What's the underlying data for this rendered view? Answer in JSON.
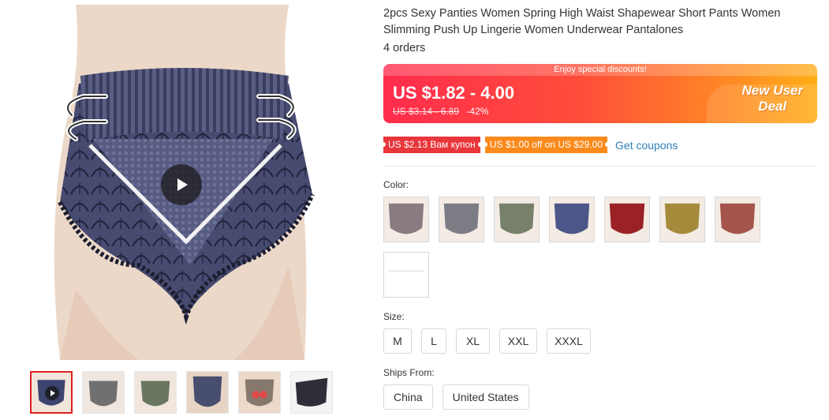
{
  "product": {
    "title": "2pcs Sexy Panties Women Spring High Waist Shapewear Short Pants Women Slimming Push Up Lingerie Women Underwear Pantalones",
    "orders": "4 orders"
  },
  "price": {
    "banner": "Enjoy special discounts!",
    "current": "US $1.82 - 4.00",
    "original": "US $3.14 - 6.89",
    "discount": "-42%",
    "badge_line1": "New User",
    "badge_line2": "Deal"
  },
  "coupons": {
    "items": [
      {
        "label": "US $2.13 Вам купон",
        "color": "#e8363b"
      },
      {
        "label": "US $1.00 off on US $29.00",
        "color": "#fa8a1c"
      }
    ],
    "get_label": "Get coupons"
  },
  "color_section": {
    "label": "Color:",
    "swatches": [
      {
        "name": "grey-pink",
        "fill": "#8a7a82"
      },
      {
        "name": "grey",
        "fill": "#7c7c84"
      },
      {
        "name": "green",
        "fill": "#76806a"
      },
      {
        "name": "blue",
        "fill": "#4c5688"
      },
      {
        "name": "red",
        "fill": "#9a2226"
      },
      {
        "name": "yellow",
        "fill": "#a48a3a"
      },
      {
        "name": "brick",
        "fill": "#a4544a"
      },
      {
        "name": "blank",
        "fill": "#ffffff"
      }
    ]
  },
  "size_section": {
    "label": "Size:",
    "options": [
      "M",
      "L",
      "XL",
      "XXL",
      "XXXL"
    ]
  },
  "ships_section": {
    "label": "Ships From:",
    "options": [
      "China",
      "United States"
    ]
  },
  "gallery": {
    "thumbs": [
      {
        "fill": "#3e4470",
        "play": true
      },
      {
        "fill": "#707070",
        "play": false
      },
      {
        "fill": "#6a7660",
        "play": false
      },
      {
        "fill": "#484e70",
        "play": false
      },
      {
        "fill": "#86786c",
        "play": false
      },
      {
        "fill": "#2e2e38",
        "play": false
      }
    ]
  },
  "colors": {
    "accent": "#ff2c4d",
    "link": "#2e7fb8",
    "product_main": "#4a4e72"
  }
}
